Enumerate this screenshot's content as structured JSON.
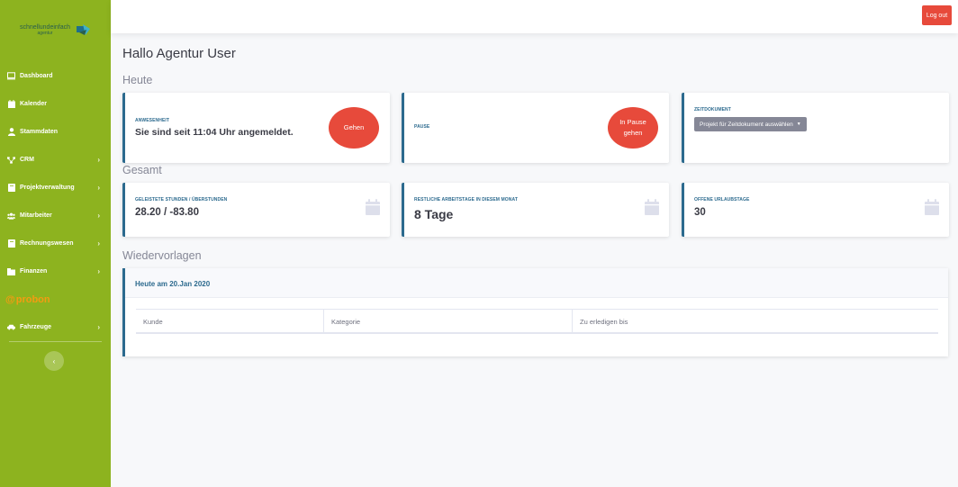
{
  "brand": {
    "name": "schnellundeinfach",
    "sub": "agentur"
  },
  "sidebar": {
    "items": [
      {
        "label": "Dashboard",
        "icon": "monitor-icon",
        "chevron": false
      },
      {
        "label": "Kalender",
        "icon": "calendar-icon",
        "chevron": false
      },
      {
        "label": "Stammdaten",
        "icon": "user-icon",
        "chevron": false
      },
      {
        "label": "CRM",
        "icon": "network-icon",
        "chevron": true
      },
      {
        "label": "Projektverwaltung",
        "icon": "book-icon",
        "chevron": true
      },
      {
        "label": "Mitarbeiter",
        "icon": "users-icon",
        "chevron": true
      },
      {
        "label": "Rechnungswesen",
        "icon": "book-icon",
        "chevron": true
      },
      {
        "label": "Finanzen",
        "icon": "folder-icon",
        "chevron": true
      }
    ],
    "probon_label": "probon",
    "fahrzeuge": {
      "label": "Fahrzeuge",
      "icon": "car-icon",
      "chevron": true
    },
    "toggle": "‹"
  },
  "topbar": {
    "logout_label": "Log out"
  },
  "greeting": "Hallo Agentur User",
  "sections": {
    "today": "Heute",
    "total": "Gesamt",
    "followups": "Wiedervorlagen"
  },
  "today": {
    "attendance": {
      "label": "Anwesenheit",
      "value": "Sie sind seit 11:04 Uhr angemeldet.",
      "button": "Gehen"
    },
    "pause": {
      "label": "Pause",
      "button_line1": "In Pause",
      "button_line2": "gehen"
    },
    "timedoc": {
      "label": "Zeitdokument",
      "select": "Projekt für Zeitdokument auswählen"
    }
  },
  "total": {
    "hours": {
      "label": "Geleistete Stunden / Überstunden",
      "value": "28.20 / -83.80"
    },
    "workdays": {
      "label": "Restliche Arbeitstage in diesem Monat",
      "value": "8 Tage"
    },
    "vacation": {
      "label": "Offene Urlaubstage",
      "value": "30"
    }
  },
  "followups": {
    "title": "Heute am 20.Jan 2020",
    "columns": [
      "Kunde",
      "Kategorie",
      "Zu erledigen bis"
    ]
  },
  "colors": {
    "sidebar": "#8db31f",
    "accent": "#2c6a8e",
    "danger": "#e74a3b",
    "probon": "#f39c12"
  }
}
